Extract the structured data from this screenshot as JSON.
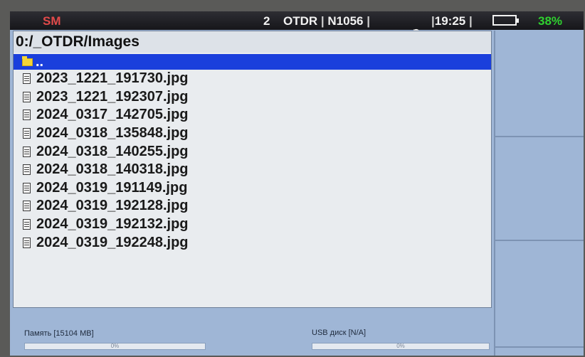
{
  "status_bar": {
    "mode": "SM",
    "channel": "2",
    "module": "OTDR",
    "separator": "|",
    "device": "N1056",
    "time": "19:25",
    "battery_percent": "38%",
    "colors": {
      "mode": "#e24a4a",
      "battery": "#2fd12f"
    }
  },
  "browser": {
    "path": "0:/_OTDR/Images",
    "parent_entry": "..",
    "files": [
      "2023_1221_191730.jpg",
      "2023_1221_192307.jpg",
      "2024_0317_142705.jpg",
      "2024_0318_135848.jpg",
      "2024_0318_140255.jpg",
      "2024_0318_140318.jpg",
      "2024_0319_191149.jpg",
      "2024_0319_192128.jpg",
      "2024_0319_192132.jpg",
      "2024_0319_192248.jpg"
    ],
    "selection_color": "#1a3fdc"
  },
  "storage": {
    "memory": {
      "label": "Память [15104 MB]",
      "usage_percent_text": "0%",
      "fill_fraction": 0
    },
    "usb": {
      "label": "USB диск [N/A]",
      "usage_percent_text": "0%",
      "fill_fraction": 0
    }
  },
  "icons": {
    "folder": "folder-icon",
    "file": "file-icon",
    "probe": "fiber-probe-icon",
    "battery": "battery-icon"
  }
}
